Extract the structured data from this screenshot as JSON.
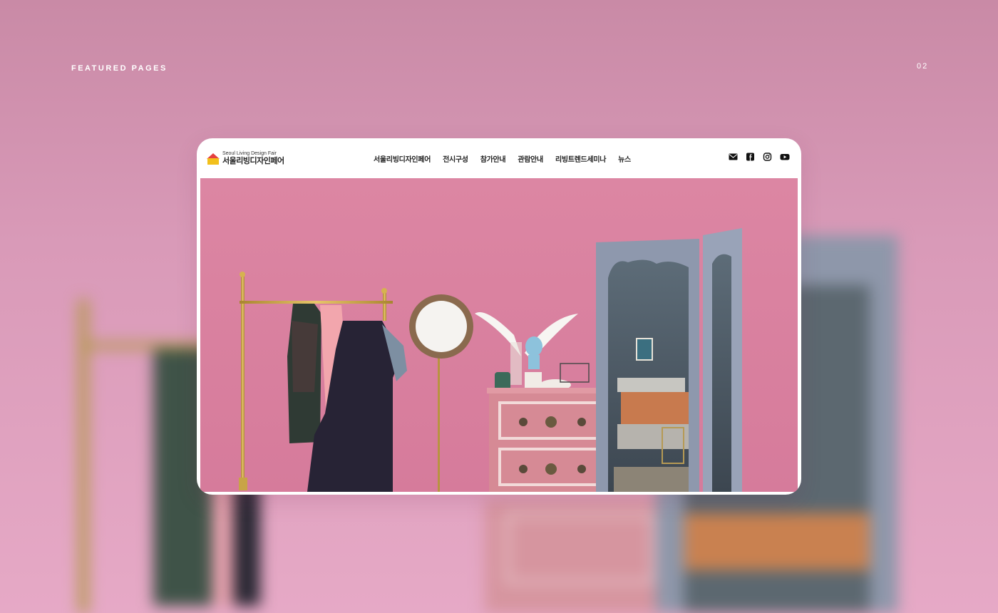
{
  "page": {
    "section_label": "FEATURED PAGES",
    "page_number": "02"
  },
  "site": {
    "logo": {
      "en": "Seoul Living Design Fair",
      "ko": "서울리빙디자인페어"
    },
    "nav": [
      {
        "label": "서울리빙디자인페어"
      },
      {
        "label": "전시구성"
      },
      {
        "label": "참가안내"
      },
      {
        "label": "관람안내"
      },
      {
        "label": "리빙트렌드세미나"
      },
      {
        "label": "뉴스"
      }
    ],
    "socials": [
      "mail-icon",
      "facebook-icon",
      "instagram-icon",
      "youtube-icon"
    ]
  },
  "colors": {
    "accent_pink": "#dd86a4",
    "nav_text": "#222222",
    "logo_red": "#e54040",
    "logo_yellow": "#f2c01c"
  }
}
